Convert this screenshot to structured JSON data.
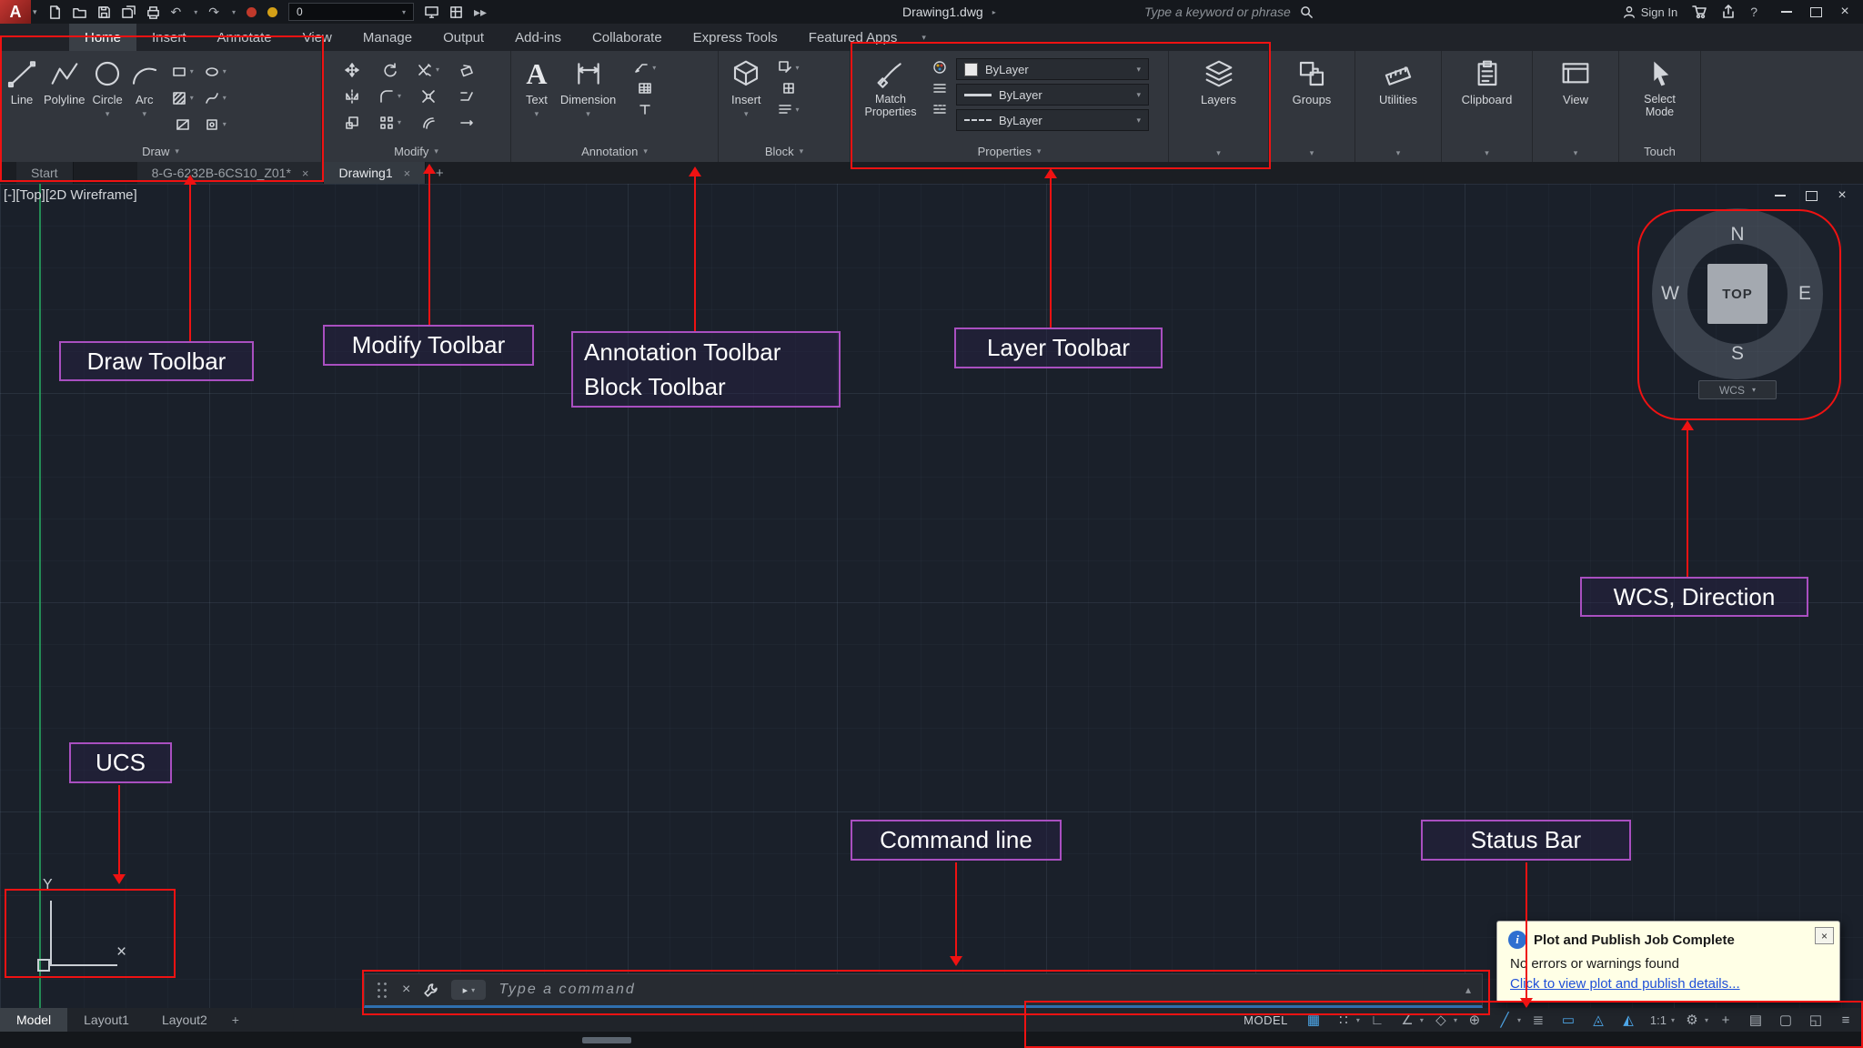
{
  "ui": {
    "caret": "▾",
    "close": "×",
    "plus": "+",
    "arrow_right": "▸",
    "arrow_up_small": "▴",
    "undo": "↶",
    "redo": "↷",
    "fast_forward": "▸▸",
    "help": "?"
  },
  "title_bar": {
    "app_initial": "A",
    "document_title": "Drawing1.dwg",
    "search_placeholder": "Type a keyword or phrase",
    "sign_in_label": "Sign In",
    "layer_value": "0"
  },
  "ribbon": {
    "tabs": [
      {
        "label": "Home",
        "active": true
      },
      {
        "label": "Insert"
      },
      {
        "label": "Annotate"
      },
      {
        "label": "View"
      },
      {
        "label": "Manage"
      },
      {
        "label": "Output"
      },
      {
        "label": "Add-ins"
      },
      {
        "label": "Collaborate"
      },
      {
        "label": "Express Tools"
      },
      {
        "label": "Featured Apps"
      }
    ],
    "draw": {
      "panel_label": "Draw",
      "line": "Line",
      "polyline": "Polyline",
      "circle": "Circle",
      "arc": "Arc"
    },
    "modify": {
      "panel_label": "Modify"
    },
    "annotation": {
      "panel_label": "Annotation",
      "text": "Text",
      "dimension": "Dimension"
    },
    "block": {
      "panel_label": "Block",
      "insert": "Insert"
    },
    "properties": {
      "panel_label": "Properties",
      "match_properties": "Match Properties",
      "color_value": "ByLayer",
      "lineweight_value": "ByLayer",
      "linetype_value": "ByLayer"
    },
    "layers": {
      "button_label": "Layers"
    },
    "groups": {
      "button_label": "Groups"
    },
    "utilities": {
      "button_label": "Utilities"
    },
    "clipboard": {
      "button_label": "Clipboard"
    },
    "view": {
      "button_label": "View"
    },
    "select_mode": {
      "button_label": "Select Mode",
      "panel_label": "Touch"
    }
  },
  "file_tabs": {
    "start": "Start",
    "drawing_a": "8-G-6232B-6CS10_Z01*",
    "drawing_b": "Drawing1"
  },
  "viewport": {
    "controls_label": "[-][Top][2D Wireframe]",
    "viewcube": {
      "north": "N",
      "south": "S",
      "east": "E",
      "west": "W",
      "face": "TOP",
      "wcs_label": "WCS"
    },
    "ucs": {
      "y_label": "Y",
      "x_marker": "×"
    }
  },
  "annotations": {
    "draw": "Draw Toolbar",
    "modify": "Modify Toolbar",
    "annotation_line1": "Annotation Toolbar",
    "annotation_line2": "Block Toolbar",
    "layer": "Layer Toolbar",
    "wcs": "WCS, Direction",
    "ucs": "UCS",
    "command": "Command line",
    "status": "Status Bar"
  },
  "command_line": {
    "placeholder": "Type a command"
  },
  "layout_tabs": {
    "model": "Model",
    "layout1": "Layout1",
    "layout2": "Layout2"
  },
  "status_bar": {
    "model_label": "MODEL",
    "icons": [
      {
        "name": "grid-mode",
        "glyph": "▦",
        "active": true
      },
      {
        "name": "snap-mode",
        "glyph": "∷",
        "caret": true
      },
      {
        "name": "ortho-mode",
        "glyph": "∟"
      },
      {
        "name": "polar-tracking",
        "glyph": "∠",
        "caret": true
      },
      {
        "name": "isometric-drafting",
        "glyph": "◇",
        "caret": true
      },
      {
        "name": "object-snap-tracking",
        "glyph": "⊕"
      },
      {
        "name": "object-snap",
        "glyph": "╱",
        "active": true,
        "caret": true
      },
      {
        "name": "lineweight-display",
        "glyph": "≣"
      },
      {
        "name": "selection-cycling",
        "glyph": "▭",
        "active": true
      },
      {
        "name": "annotation-visibility",
        "glyph": "◬",
        "active": true
      },
      {
        "name": "annotation-autoscale",
        "glyph": "◭",
        "active": true
      },
      {
        "name": "annotation-scale",
        "glyph": "1:1",
        "caret": true
      },
      {
        "name": "workspace-switching",
        "glyph": "⚙",
        "caret": true
      },
      {
        "name": "annotation-monitor",
        "glyph": "+"
      },
      {
        "name": "plot",
        "glyph": "▤"
      },
      {
        "name": "isolate-objects",
        "glyph": "▢"
      },
      {
        "name": "graphics-performance",
        "glyph": "◱"
      },
      {
        "name": "customize",
        "glyph": "≡"
      }
    ]
  },
  "notification": {
    "title": "Plot and Publish Job Complete",
    "body": "No errors or warnings found",
    "link": "Click to view plot and publish details..."
  }
}
